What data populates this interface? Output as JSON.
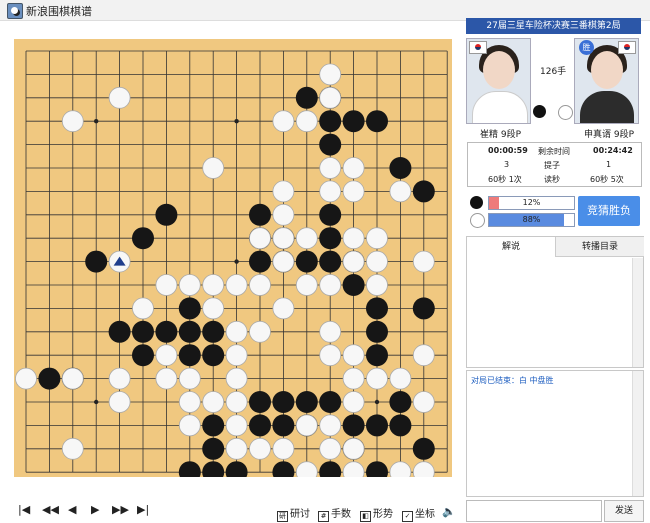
{
  "window": {
    "title": "新浪围棋棋谱"
  },
  "match": {
    "title": "27届三星车险杯决赛三番棋第2局",
    "move_count": "126手",
    "winner_badge": "胜"
  },
  "players": {
    "black": {
      "name": "崔精 9段P",
      "time_used": "00:00:59",
      "captures": "3",
      "byoyomi": "60秒 1次"
    },
    "white": {
      "name": "申真谞 9段P",
      "time_used": "00:24:42",
      "captures": "1",
      "byoyomi": "60秒 5次"
    }
  },
  "info_labels": {
    "time": "剩余时间",
    "captures": "提子",
    "byoyomi": "读秒"
  },
  "win_rate": {
    "black_label": "12%",
    "white_label": "88%",
    "black": 0.12,
    "white": 0.88
  },
  "buttons": {
    "guess": "竞猜胜负",
    "send": "发送"
  },
  "tabs": [
    {
      "label": "解说"
    },
    {
      "label": "转播目录"
    }
  ],
  "result_text": "对局已结束：白 中盘胜",
  "tools": [
    {
      "label": "研讨"
    },
    {
      "label": "手数"
    },
    {
      "label": "形势"
    },
    {
      "label": "坐标"
    }
  ],
  "nav_icons": [
    "first-icon",
    "fast-back-icon",
    "back-icon",
    "forward-icon",
    "fast-forward-icon",
    "last-icon"
  ],
  "colors": {
    "board": "#f0c880",
    "accent": "#2c57a8",
    "black_bar": "#ee7b7b",
    "white_bar": "#5a8be0"
  },
  "board": {
    "size": 19,
    "black": [
      [
        13,
        3
      ],
      [
        14,
        3
      ],
      [
        14,
        4
      ],
      [
        15,
        4
      ],
      [
        16,
        4
      ],
      [
        14,
        5
      ],
      [
        17,
        6
      ],
      [
        18,
        7
      ],
      [
        7,
        8
      ],
      [
        11,
        8
      ],
      [
        14,
        8
      ],
      [
        6,
        9
      ],
      [
        11,
        9
      ],
      [
        12,
        9
      ],
      [
        14,
        9
      ],
      [
        4,
        10
      ],
      [
        11,
        10
      ],
      [
        12,
        10
      ],
      [
        13,
        10
      ],
      [
        14,
        10
      ],
      [
        15,
        10
      ],
      [
        15,
        11
      ],
      [
        8,
        12
      ],
      [
        16,
        12
      ],
      [
        18,
        12
      ],
      [
        5,
        13
      ],
      [
        6,
        13
      ],
      [
        7,
        13
      ],
      [
        8,
        13
      ],
      [
        9,
        13
      ],
      [
        16,
        13
      ],
      [
        6,
        14
      ],
      [
        8,
        14
      ],
      [
        9,
        14
      ],
      [
        16,
        14
      ],
      [
        2,
        15
      ],
      [
        3,
        15
      ],
      [
        11,
        16
      ],
      [
        12,
        16
      ],
      [
        13,
        16
      ],
      [
        14,
        16
      ],
      [
        17,
        16
      ],
      [
        9,
        17
      ],
      [
        11,
        17
      ],
      [
        12,
        17
      ],
      [
        13,
        17
      ],
      [
        15,
        17
      ],
      [
        16,
        17
      ],
      [
        17,
        17
      ],
      [
        9,
        18
      ],
      [
        15,
        18
      ],
      [
        18,
        18
      ],
      [
        8,
        19
      ],
      [
        9,
        19
      ],
      [
        10,
        19
      ],
      [
        12,
        19
      ],
      [
        14,
        19
      ],
      [
        16,
        19
      ],
      [
        9,
        20
      ],
      [
        15,
        20
      ]
    ],
    "white": [
      [
        14,
        2
      ],
      [
        5,
        3
      ],
      [
        14,
        3
      ],
      [
        3,
        4
      ],
      [
        12,
        4
      ],
      [
        13,
        4
      ],
      [
        14,
        6
      ],
      [
        9,
        6
      ],
      [
        15,
        6
      ],
      [
        12,
        7
      ],
      [
        14,
        7
      ],
      [
        15,
        7
      ],
      [
        17,
        7
      ],
      [
        12,
        8
      ],
      [
        11,
        9
      ],
      [
        12,
        9
      ],
      [
        13,
        9
      ],
      [
        15,
        9
      ],
      [
        16,
        9
      ],
      [
        5,
        10
      ],
      [
        12,
        10
      ],
      [
        15,
        10
      ],
      [
        16,
        10
      ],
      [
        18,
        10
      ],
      [
        7,
        11
      ],
      [
        8,
        11
      ],
      [
        9,
        11
      ],
      [
        10,
        11
      ],
      [
        11,
        11
      ],
      [
        13,
        11
      ],
      [
        14,
        11
      ],
      [
        16,
        11
      ],
      [
        6,
        12
      ],
      [
        9,
        12
      ],
      [
        12,
        12
      ],
      [
        10,
        13
      ],
      [
        11,
        13
      ],
      [
        14,
        13
      ],
      [
        7,
        14
      ],
      [
        10,
        14
      ],
      [
        14,
        14
      ],
      [
        15,
        14
      ],
      [
        18,
        14
      ],
      [
        1,
        15
      ],
      [
        3,
        15
      ],
      [
        5,
        15
      ],
      [
        7,
        15
      ],
      [
        8,
        15
      ],
      [
        10,
        15
      ],
      [
        15,
        15
      ],
      [
        16,
        15
      ],
      [
        17,
        15
      ],
      [
        5,
        16
      ],
      [
        8,
        16
      ],
      [
        9,
        16
      ],
      [
        10,
        16
      ],
      [
        15,
        16
      ],
      [
        18,
        16
      ],
      [
        8,
        17
      ],
      [
        10,
        17
      ],
      [
        13,
        17
      ],
      [
        14,
        17
      ],
      [
        3,
        18
      ],
      [
        10,
        18
      ],
      [
        11,
        18
      ],
      [
        12,
        18
      ],
      [
        14,
        18
      ],
      [
        15,
        18
      ],
      [
        13,
        19
      ],
      [
        15,
        19
      ],
      [
        17,
        19
      ],
      [
        18,
        19
      ]
    ],
    "last_move": [
      5,
      10
    ]
  }
}
